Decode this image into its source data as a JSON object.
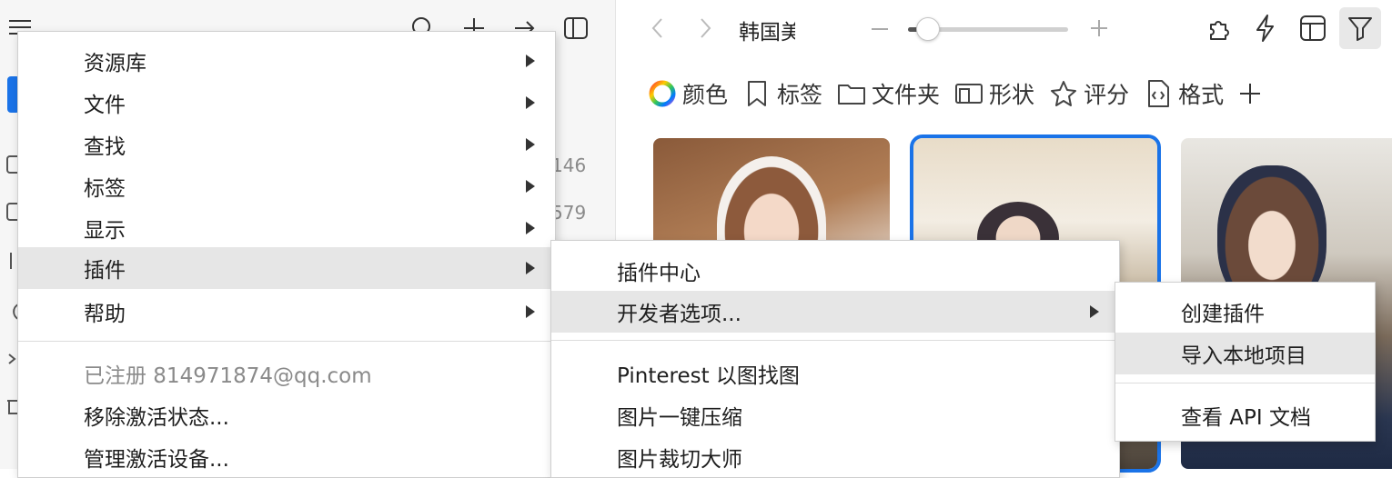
{
  "sidebar": {
    "counts": [
      "146",
      "579"
    ]
  },
  "toolbar": {
    "breadcrumb": "韩国美",
    "zoom_level": 0.12
  },
  "filters": [
    {
      "icon": "color-wheel-icon",
      "label": "颜色"
    },
    {
      "icon": "bookmark-icon",
      "label": "标签"
    },
    {
      "icon": "folder-icon",
      "label": "文件夹"
    },
    {
      "icon": "shape-icon",
      "label": "形状"
    },
    {
      "icon": "star-icon",
      "label": "评分"
    },
    {
      "icon": "file-code-icon",
      "label": "格式"
    }
  ],
  "menu_main": {
    "items": [
      {
        "label": "资源库",
        "submenu": true
      },
      {
        "label": "文件",
        "submenu": true
      },
      {
        "label": "查找",
        "submenu": true
      },
      {
        "label": "标签",
        "submenu": true
      },
      {
        "label": "显示",
        "submenu": true
      },
      {
        "label": "插件",
        "submenu": true,
        "highlighted": true
      },
      {
        "label": "帮助",
        "submenu": true
      }
    ],
    "registered": "已注册 814971874@qq.com",
    "remove_activation": "移除激活状态...",
    "manage_devices": "管理激活设备..."
  },
  "menu_plugins": {
    "center": "插件中心",
    "developer": "开发者选项...",
    "pinterest": "Pinterest 以图找图",
    "compress": "图片一键压缩",
    "crop": "图片裁切大师"
  },
  "menu_dev": {
    "create": "创建插件",
    "import": "导入本地项目",
    "api_docs": "查看 API 文档"
  },
  "colors": {
    "selection": "#1a73e8",
    "highlight": "#e6e6e6",
    "accent_blue": "#1a73e8"
  }
}
